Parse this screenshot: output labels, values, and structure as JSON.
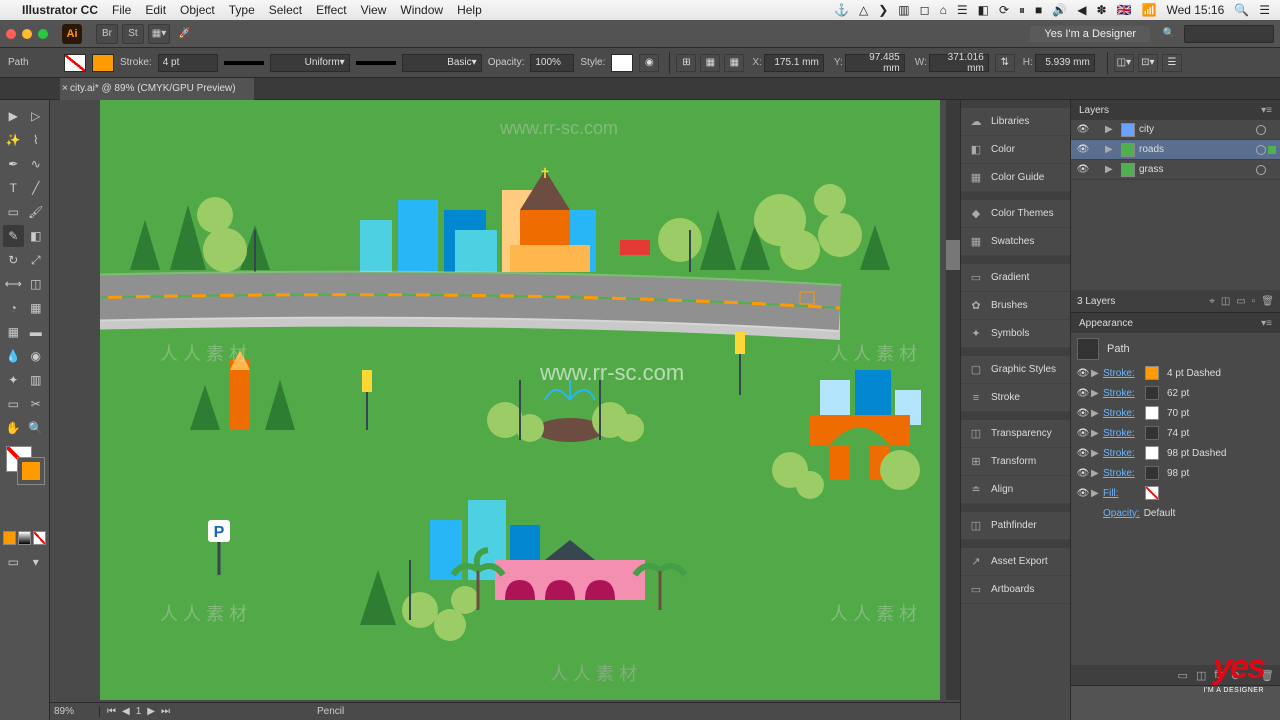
{
  "mac": {
    "app_name": "Illustrator CC",
    "menus": [
      "File",
      "Edit",
      "Object",
      "Type",
      "Select",
      "Effect",
      "View",
      "Window",
      "Help"
    ],
    "status_icons": [
      "⚓",
      "◈",
      "⟩",
      "▥",
      "▣",
      "⌂",
      "☰",
      "◧",
      "⟳",
      "⏸",
      "⬛",
      "🔊",
      "◀",
      "※",
      "🇬🇧",
      "📶"
    ],
    "clock": "Wed 15:16",
    "right_icons": [
      "🔍",
      "☰"
    ]
  },
  "appbar": {
    "workspace": "Yes I'm a Designer"
  },
  "control": {
    "selection": "Path",
    "stroke_label": "Stroke:",
    "stroke_weight": "4 pt",
    "stroke_profile": "Uniform",
    "brush": "Basic",
    "opacity_label": "Opacity:",
    "opacity": "100%",
    "style_label": "Style:",
    "x_label": "X:",
    "x": "175.1 mm",
    "y_label": "Y:",
    "y": "97.485 mm",
    "w_label": "W:",
    "w": "371.016 mm",
    "h_label": "H:",
    "h": "5.939 mm"
  },
  "doc": {
    "tab": "city.ai* @ 89% (CMYK/GPU Preview)"
  },
  "status": {
    "zoom": "89%",
    "artboard": "1",
    "tool": "Pencil"
  },
  "dock": [
    "Libraries",
    "Color",
    "Color Guide",
    "Color Themes",
    "Swatches",
    "Gradient",
    "Brushes",
    "Symbols",
    "Graphic Styles",
    "Stroke",
    "Transparency",
    "Transform",
    "Align",
    "Pathfinder",
    "Asset Export",
    "Artboards"
  ],
  "dock_icons": [
    "☁",
    "◧",
    "▦",
    "◆",
    "▦",
    "▭",
    "✿",
    "✦",
    "▢",
    "≡",
    "◫",
    "⊞",
    "≐",
    "◫",
    "↗",
    "▭"
  ],
  "layers": {
    "tab": "Layers",
    "items": [
      {
        "name": "city",
        "color": "#6aa3ff",
        "selected": false
      },
      {
        "name": "roads",
        "color": "#4fb04f",
        "selected": true
      },
      {
        "name": "grass",
        "color": "#4fb04f",
        "selected": false
      }
    ],
    "footer": "3 Layers"
  },
  "appearance": {
    "tab": "Appearance",
    "type": "Path",
    "rows": [
      {
        "label": "Stroke:",
        "swatch": "#ff9a00",
        "value": "4 pt Dashed"
      },
      {
        "label": "Stroke:",
        "swatch": "none",
        "value": "62 pt"
      },
      {
        "label": "Stroke:",
        "swatch": "#ffffff",
        "value": "70 pt"
      },
      {
        "label": "Stroke:",
        "swatch": "none",
        "value": "74 pt"
      },
      {
        "label": "Stroke:",
        "swatch": "#ffffff",
        "value": "98 pt Dashed"
      },
      {
        "label": "Stroke:",
        "swatch": "none",
        "value": "98 pt"
      },
      {
        "label": "Fill:",
        "swatch": "diag",
        "value": ""
      }
    ],
    "opacity_label": "Opacity:",
    "opacity_value": "Default"
  },
  "watermark_url": "www.rr-sc.com",
  "watermark_cn": "人 人 素 材"
}
